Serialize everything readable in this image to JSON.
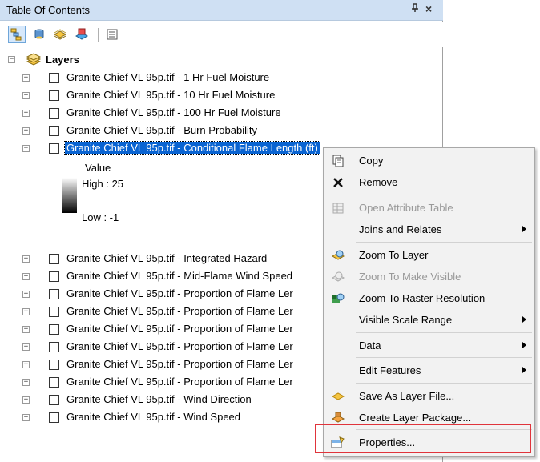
{
  "window": {
    "title": "Table Of Contents",
    "pin": "ᵖ",
    "close": "×"
  },
  "toolbar": {
    "buttons": [
      {
        "icon": "list-by-drawing-order-icon"
      },
      {
        "icon": "list-by-source-icon"
      },
      {
        "icon": "list-by-visibility-icon"
      },
      {
        "icon": "list-by-selection-icon"
      },
      {
        "icon": "options-icon"
      }
    ]
  },
  "tree": {
    "root_label": "Layers",
    "layers": [
      {
        "label": "Granite Chief VL 95p.tif - 1 Hr Fuel Moisture"
      },
      {
        "label": "Granite Chief VL 95p.tif - 10 Hr Fuel Moisture"
      },
      {
        "label": "Granite Chief VL 95p.tif - 100 Hr Fuel Moisture"
      },
      {
        "label": "Granite Chief VL 95p.tif - Burn Probability"
      },
      {
        "label": "Granite Chief VL 95p.tif - Conditional Flame Length (ft)"
      },
      {
        "label": "Granite Chief VL 95p.tif - Integrated Hazard"
      },
      {
        "label": "Granite Chief VL 95p.tif - Mid-Flame Wind Speed"
      },
      {
        "label": "Granite Chief VL 95p.tif - Proportion of Flame Ler"
      },
      {
        "label": "Granite Chief VL 95p.tif - Proportion of Flame Ler"
      },
      {
        "label": "Granite Chief VL 95p.tif - Proportion of Flame Ler"
      },
      {
        "label": "Granite Chief VL 95p.tif - Proportion of Flame Ler"
      },
      {
        "label": "Granite Chief VL 95p.tif - Proportion of Flame Ler"
      },
      {
        "label": "Granite Chief VL 95p.tif - Proportion of Flame Ler"
      },
      {
        "label": "Granite Chief VL 95p.tif - Wind Direction"
      },
      {
        "label": "Granite Chief VL 95p.tif - Wind Speed"
      }
    ],
    "legend": {
      "heading": "Value",
      "high": "High : 25",
      "low": "Low : -1"
    }
  },
  "context_menu": {
    "items": [
      {
        "label": "Copy",
        "icon": "copy-icon",
        "enabled": true,
        "submenu": false
      },
      {
        "label": "Remove",
        "icon": "remove-x-icon",
        "enabled": true,
        "submenu": false
      },
      {
        "label": "Open Attribute Table",
        "icon": "table-icon",
        "enabled": false,
        "submenu": false
      },
      {
        "label": "Joins and Relates",
        "icon": "",
        "enabled": true,
        "submenu": true
      },
      {
        "label": "Zoom To Layer",
        "icon": "zoom-to-layer-icon",
        "enabled": true,
        "submenu": false
      },
      {
        "label": "Zoom To Make Visible",
        "icon": "zoom-to-visible-icon",
        "enabled": false,
        "submenu": false
      },
      {
        "label": "Zoom To Raster Resolution",
        "icon": "raster-resolution-icon",
        "enabled": true,
        "submenu": false
      },
      {
        "label": "Visible Scale Range",
        "icon": "",
        "enabled": true,
        "submenu": true
      },
      {
        "label": "Data",
        "icon": "",
        "enabled": true,
        "submenu": true
      },
      {
        "label": "Edit Features",
        "icon": "",
        "enabled": true,
        "submenu": true
      },
      {
        "label": "Save As Layer File...",
        "icon": "save-layer-icon",
        "enabled": true,
        "submenu": false
      },
      {
        "label": "Create Layer Package...",
        "icon": "layer-package-icon",
        "enabled": true,
        "submenu": false
      },
      {
        "label": "Properties...",
        "icon": "properties-icon",
        "enabled": true,
        "submenu": false
      }
    ]
  },
  "colors": {
    "selection": "#0a64d2",
    "highlight_box": "#e0343b",
    "title_bar": "#cfe0f3"
  }
}
